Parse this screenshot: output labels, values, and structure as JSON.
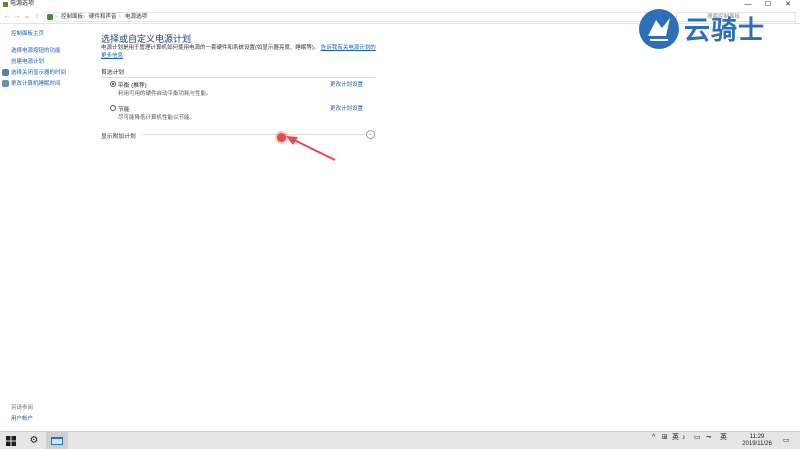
{
  "window": {
    "title": "电源选项",
    "minimize": "—",
    "maximize": "☐",
    "close": "✕"
  },
  "address": {
    "crumbs": [
      "控制面板",
      "硬件和声音",
      "电源选项"
    ],
    "search_placeholder": "搜索控制面板"
  },
  "watermark": {
    "text": "云骑士"
  },
  "leftnav": {
    "home": "控制面板主页",
    "links": [
      "选择电源按钮的功能",
      "创建电源计划",
      "选择关闭显示器的时间",
      "更改计算机睡眠时间"
    ],
    "see_also_header": "另请参阅",
    "see_also": [
      "用户帐户"
    ]
  },
  "main": {
    "title": "选择或自定义电源计划",
    "desc": "电源计划是用于管理计算机如何使用电源的一套硬件和系统设置(如显示器亮度、睡眠等)。",
    "desc_link": "告诉我有关电源计划的更多信息",
    "section_label": "首选计划",
    "plans": [
      {
        "name": "平衡 (推荐)",
        "sub": "利用可用的硬件自动平衡功耗与性能。",
        "link": "更改计划设置",
        "selected": true
      },
      {
        "name": "节能",
        "sub": "尽可能降低计算机性能以节能。",
        "link": "更改计划设置",
        "selected": false
      }
    ],
    "extra_label": "显示附加计划",
    "expand_icon": "⌄"
  },
  "taskbar": {
    "start_icon": "windows-icon",
    "tray": [
      "^",
      "⊞",
      "英",
      "♪",
      "▭",
      "⏦"
    ],
    "lang": "英",
    "time": "11:29",
    "date": "2019/11/26"
  },
  "colors": {
    "accent": "#1a5fb4",
    "title": "#1e3f7d",
    "taskbar": "#e6e6e6",
    "cursor": "#e7474a",
    "watermark": "#2d6fb8"
  }
}
